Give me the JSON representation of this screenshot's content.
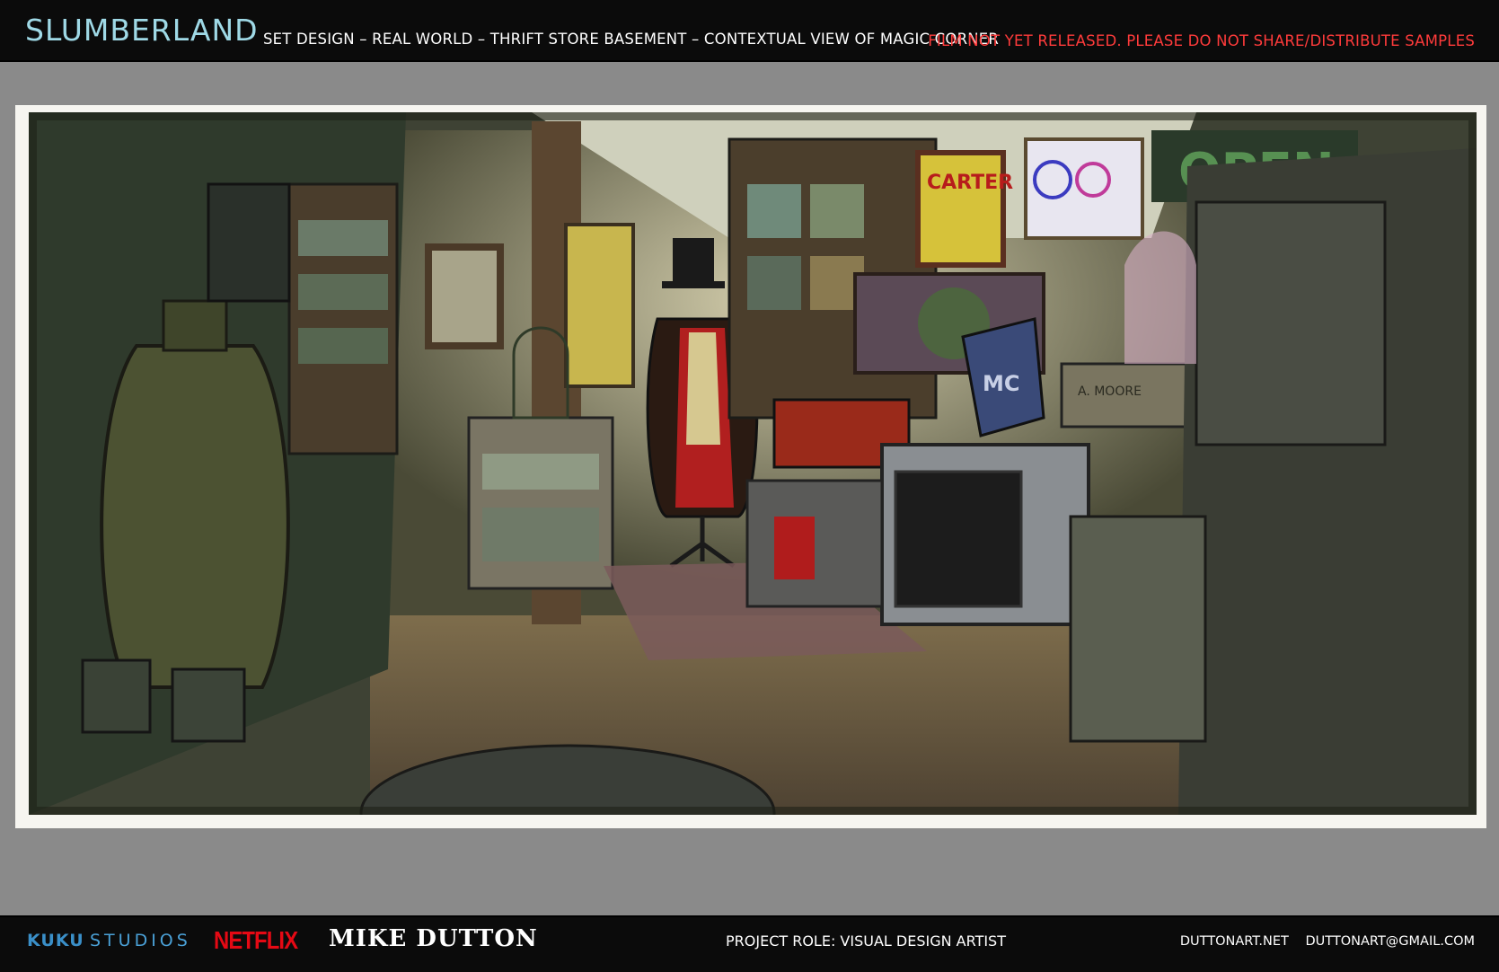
{
  "header": {
    "logo": "SLUMBERLAND",
    "subtitle": "SET DESIGN – REAL WORLD – THRIFT STORE BASEMENT – CONTEXTUAL VIEW OF MAGIC CORNER",
    "warning": "FILM NOT YET RELEASED. PLEASE DO NOT SHARE/DISTRIBUTE SAMPLES",
    "logo_color": "#9fd9e6",
    "warning_color": "#ff3b3b"
  },
  "artwork": {
    "poster_left": "CARTER",
    "sign": "OPEN",
    "crate_label": "A. MOORE",
    "case_label": "MC"
  },
  "footer": {
    "kuku": "KUKU",
    "studios": "STUDIOS",
    "netflix": "NETFLIX",
    "artist": "MIKE DUTTON",
    "role": "PROJECT ROLE: VISUAL DESIGN ARTIST",
    "site": "DUTTONART.NET",
    "email": "DUTTONART@GMAIL.COM",
    "kuku_color": "#3a8fc8",
    "netflix_color": "#e50914"
  }
}
